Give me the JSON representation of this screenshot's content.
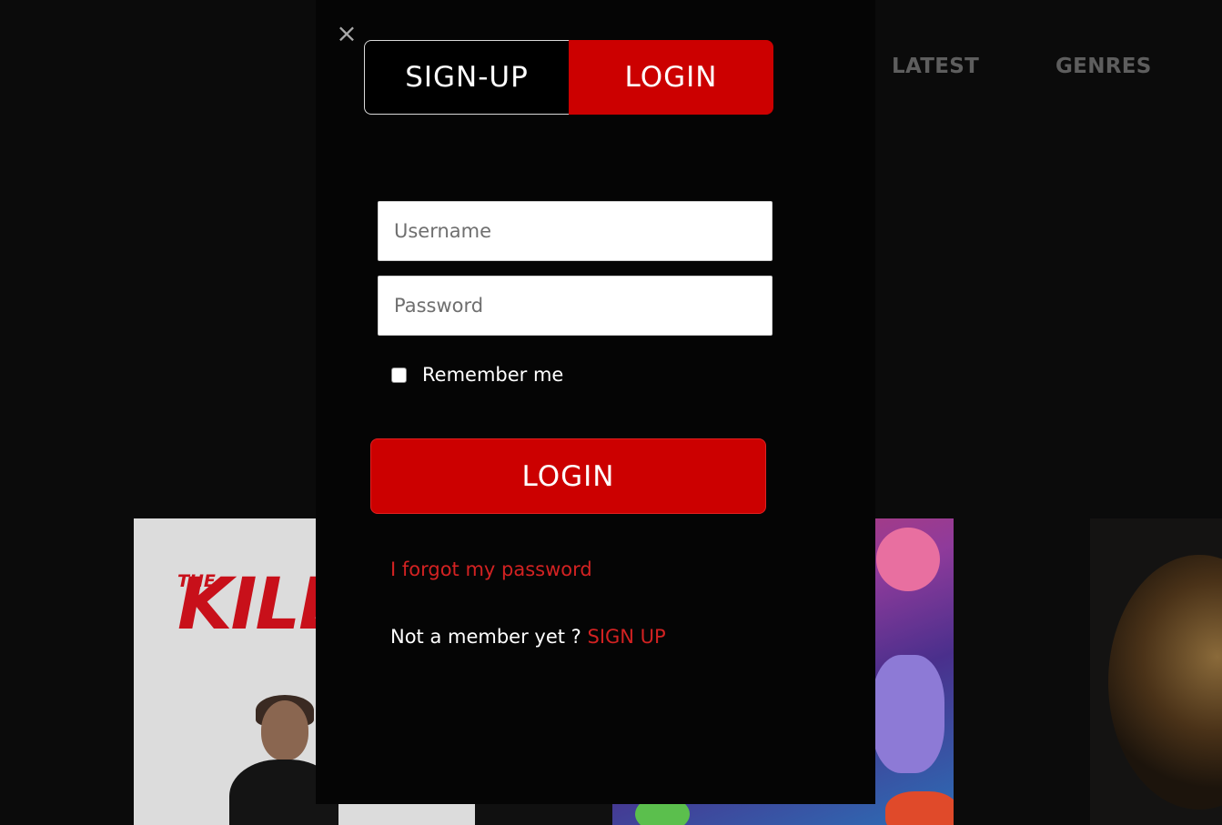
{
  "nav": {
    "items": [
      {
        "label": "LATEST"
      },
      {
        "label": "GENRES"
      }
    ]
  },
  "posters": {
    "killer": {
      "the_text": "THE",
      "title_text": "KILL"
    }
  },
  "modal": {
    "close_icon": "×",
    "tabs": [
      {
        "label": "SIGN-UP",
        "active": false
      },
      {
        "label": "LOGIN",
        "active": true
      }
    ],
    "username": {
      "placeholder": "Username",
      "value": ""
    },
    "password": {
      "placeholder": "Password",
      "value": ""
    },
    "remember": {
      "label": "Remember me",
      "checked": false
    },
    "login_button": "LOGIN",
    "forgot_link": "I forgot my password",
    "member_prompt": "Not a member yet ?",
    "signup_link": "SIGN UP"
  },
  "colors": {
    "accent": "#cc0000",
    "link": "#d32222",
    "modal_bg": "#050505",
    "page_bg": "#0b0b0b"
  }
}
